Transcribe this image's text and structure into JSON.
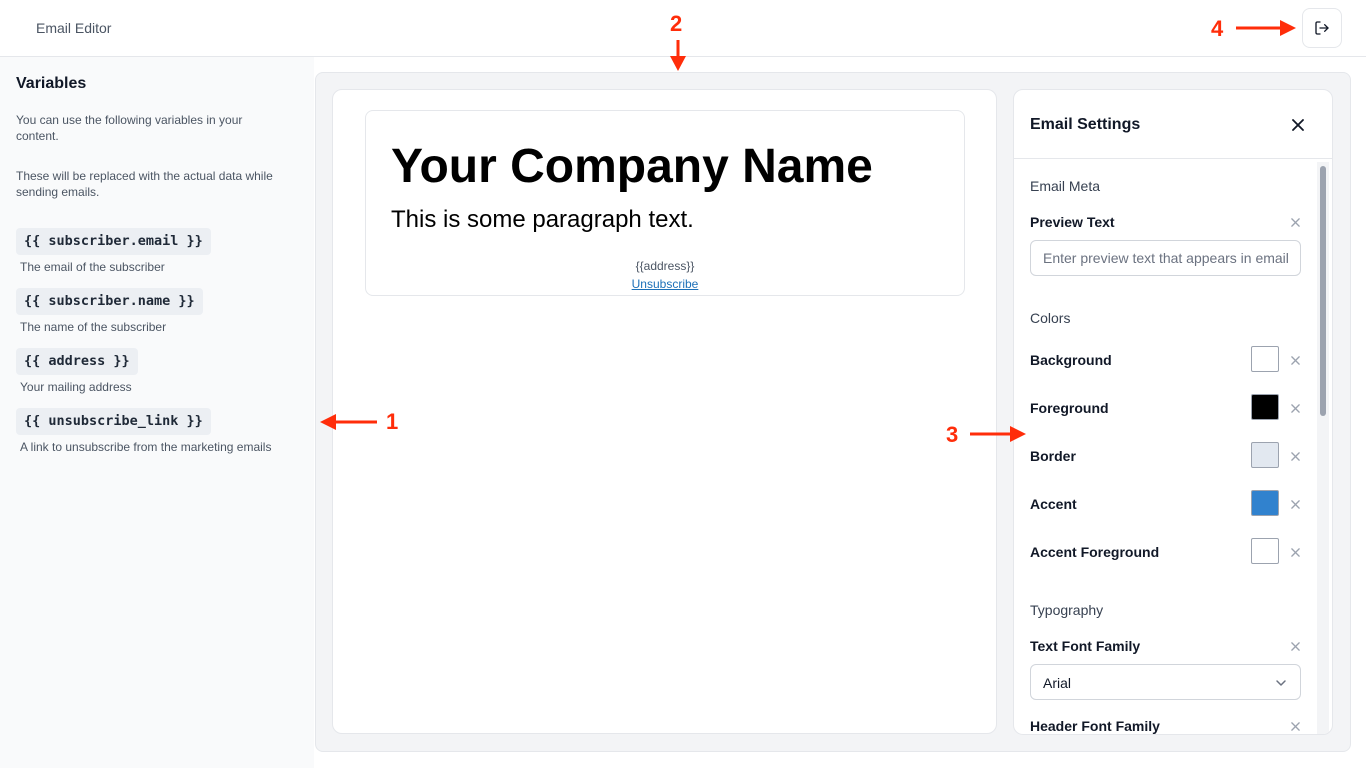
{
  "header": {
    "title": "Email Editor",
    "logout_icon": "logout-icon"
  },
  "sidebar": {
    "title": "Variables",
    "description1": "You can use the following variables in your content.",
    "description2": "These will be replaced with the actual data while sending emails.",
    "variables": [
      {
        "code": "{{ subscriber.email }}",
        "description": "The email of the subscriber"
      },
      {
        "code": "{{ subscriber.name }}",
        "description": "The name of the subscriber"
      },
      {
        "code": "{{ address }}",
        "description": "Your mailing address"
      },
      {
        "code": "{{ unsubscribe_link }}",
        "description": "A link to unsubscribe from the marketing emails"
      }
    ]
  },
  "email": {
    "heading": "Your Company Name",
    "paragraph": "This is some paragraph text.",
    "address": "{{address}}",
    "unsubscribe": "Unsubscribe"
  },
  "settings": {
    "title": "Email Settings",
    "meta_section": "Email Meta",
    "preview_label": "Preview Text",
    "preview_placeholder": "Enter preview text that appears in email client",
    "colors_section": "Colors",
    "colors": [
      {
        "label": "Background",
        "value": "#ffffff"
      },
      {
        "label": "Foreground",
        "value": "#000000"
      },
      {
        "label": "Border",
        "value": "#e2e8f0"
      },
      {
        "label": "Accent",
        "value": "#3182ce"
      },
      {
        "label": "Accent Foreground",
        "value": "#ffffff"
      }
    ],
    "typography_section": "Typography",
    "text_font_label": "Text Font Family",
    "text_font_value": "Arial",
    "header_font_label": "Header Font Family"
  },
  "annotations": {
    "a1": "1",
    "a2": "2",
    "a3": "3",
    "a4": "4"
  },
  "accent_annotation_color": "#ff2d0a"
}
